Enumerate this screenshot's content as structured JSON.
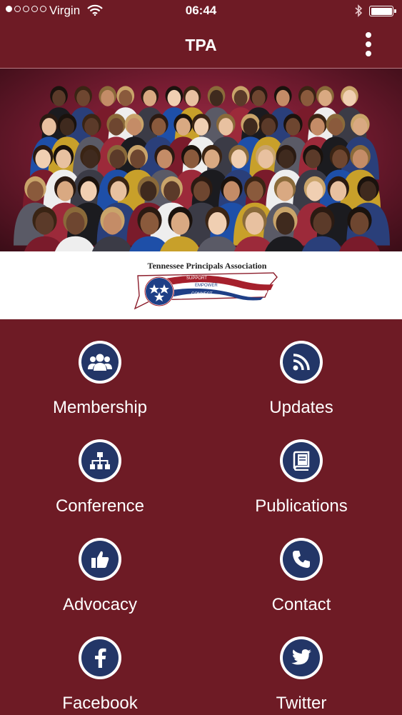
{
  "status_bar": {
    "carrier": "Virgin",
    "time": "06:44",
    "signal_strength": 1,
    "signal_dots": 5
  },
  "app_bar": {
    "title": "TPA",
    "menu_icon": "more-vert-icon"
  },
  "hero": {
    "image": "group-photo-association-members"
  },
  "logo": {
    "name": "Tennessee Principals Association",
    "tagline_1": "SUPPORT",
    "tagline_2": "EMPOWER",
    "tagline_3": "CONNECT"
  },
  "menu": {
    "items": [
      {
        "label": "Membership",
        "icon": "people-group-icon"
      },
      {
        "label": "Updates",
        "icon": "rss-feed-icon"
      },
      {
        "label": "Conference",
        "icon": "sitemap-icon"
      },
      {
        "label": "Publications",
        "icon": "book-icon"
      },
      {
        "label": "Advocacy",
        "icon": "thumbs-up-icon"
      },
      {
        "label": "Contact",
        "icon": "phone-icon"
      },
      {
        "label": "Facebook",
        "icon": "facebook-icon"
      },
      {
        "label": "Twitter",
        "icon": "twitter-icon"
      }
    ]
  },
  "colors": {
    "background": "#6e1b25",
    "icon_fill": "#233667",
    "icon_ring": "#ffffff",
    "text": "#ffffff"
  }
}
